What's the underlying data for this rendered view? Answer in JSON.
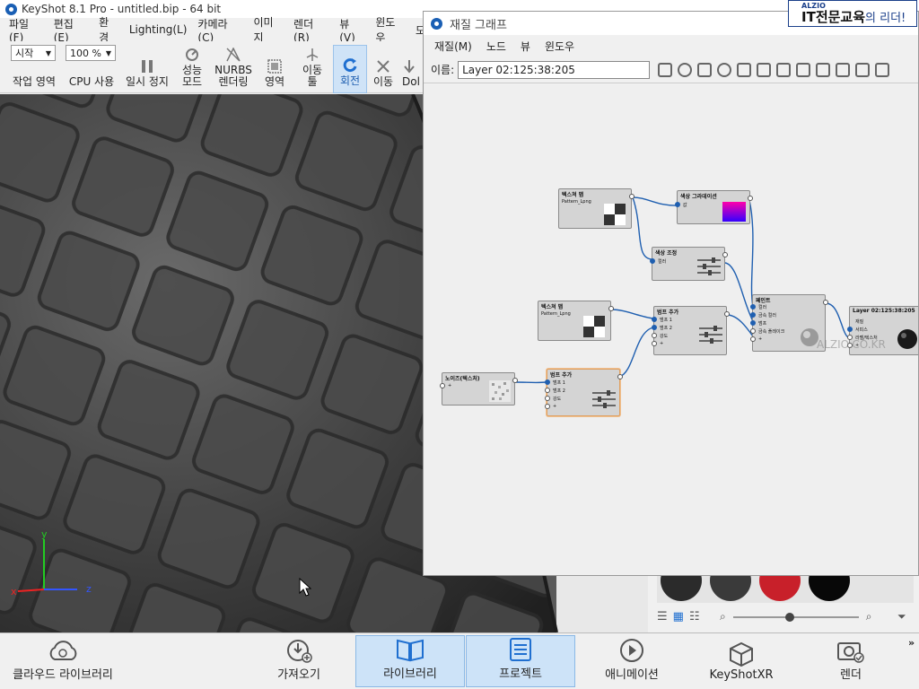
{
  "titlebar": {
    "title": "KeyShot 8.1 Pro  - untitled.bip  - 64 bit"
  },
  "menu": [
    "파일(F)",
    "편집(E)",
    "환경",
    "Lighting(L)",
    "카메라(C)",
    "이미지",
    "렌더(R)",
    "뷰(V)",
    "윈도우",
    "모"
  ],
  "toolbar": {
    "workspace_value": "시작",
    "cpu_value": "100 %",
    "workspace_label": "작업 영역",
    "cpu_label": "CPU 사용",
    "pause_label": "일시 정지",
    "perf_label": "성능\n모드",
    "nurbs_label": "NURBS\n렌더링",
    "region_label": "영역",
    "move_tool_label": "이동\n툴",
    "rotate_label": "회전",
    "pan_label": "이동",
    "dolly_label": "Dol"
  },
  "brand": {
    "small": "ALZIO",
    "big": "IT전문교육",
    "suffix": "의 리더!"
  },
  "graph": {
    "title": "재질 그래프",
    "menu": [
      "재질(M)",
      "노드",
      "뷰",
      "윈도우"
    ],
    "name_label": "이름:",
    "name_value": "Layer 02:125:38:205",
    "watermark": "ALZIO.CO.KR",
    "nodes": {
      "tex1": {
        "title": "텍스쳐 맵",
        "sub": "Pattern_Lpng"
      },
      "grad": {
        "title": "색상 그라데이션",
        "p1": "값"
      },
      "adj": {
        "title": "색상 조정",
        "p1": "컬러"
      },
      "tex2": {
        "title": "텍스쳐 맵",
        "sub": "Pattern_Lpng"
      },
      "bump1": {
        "title": "범프 추가",
        "p1": "범프 1",
        "p2": "범프 2",
        "p3": "강도",
        "p4": "+"
      },
      "paint": {
        "title": "페인트",
        "p1": "컬러",
        "p2": "금속 컬러",
        "p3": "범프",
        "p4": "금속 플레이크",
        "p5": "+"
      },
      "layer": {
        "title": "Layer 02:125:38:205",
        "p1": "재질",
        "p2": "서피스",
        "p3": "라벨/텍스처",
        "p4": "+"
      },
      "noise": {
        "title": "노이즈(텍스처)",
        "p1": "+"
      },
      "bump2": {
        "title": "범프 추가",
        "p1": "범프 1",
        "p2": "범프 2",
        "p3": "강도",
        "p4": "+"
      }
    }
  },
  "bottom": {
    "cloud": "클라우드 라이브러리",
    "import": "가져오기",
    "library": "라이브러리",
    "project": "프로젝트",
    "animation": "애니메이션",
    "keyshotxr": "KeyShotXR",
    "render": "렌더"
  },
  "axis": {
    "x": "x",
    "y": "y",
    "z": "z"
  },
  "colors": {
    "accent": "#1f5fb0",
    "active_bg": "#cde3f8",
    "gradient_start": "#ff00aa",
    "gradient_end": "#3300ff"
  }
}
